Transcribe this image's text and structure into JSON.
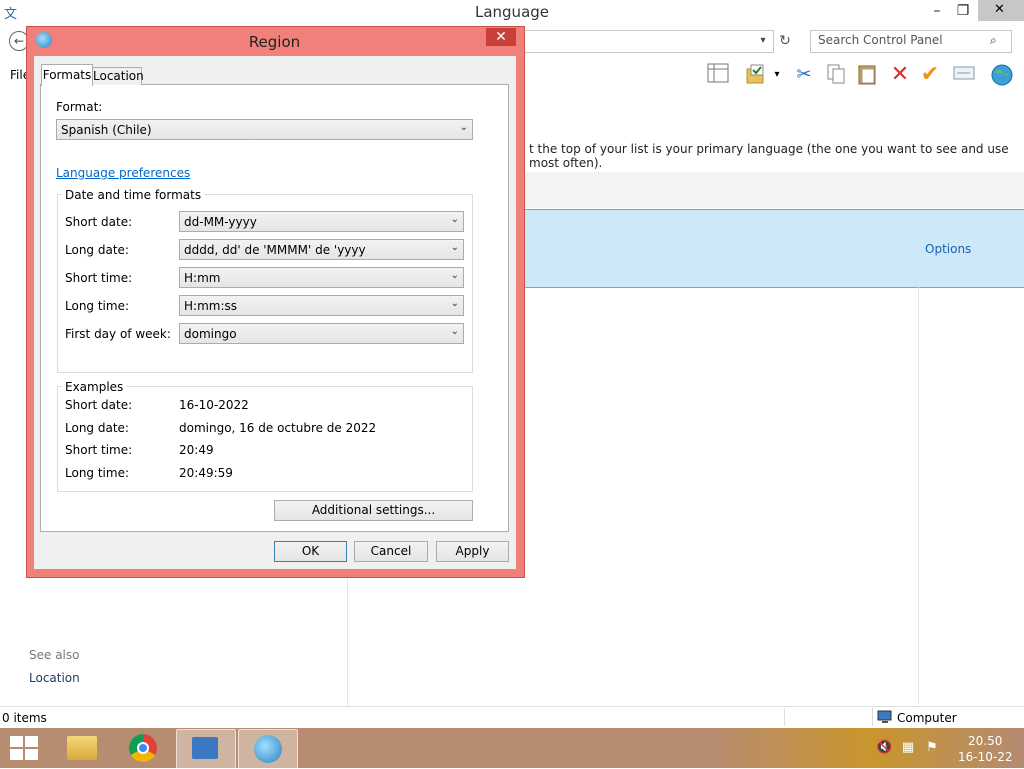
{
  "window": {
    "title": "Language",
    "min_glyph": "–",
    "max_glyph": "❐",
    "close_glyph": "✕"
  },
  "nav": {
    "back_glyph": "←",
    "dropdown_glyph": "▾",
    "refresh_glyph": "↻",
    "search_placeholder": "Search Control Panel",
    "search_glyph": "⌕"
  },
  "menu": {
    "file": "File"
  },
  "toolbar_icons": [
    "layout-icon",
    "folder-check-icon",
    "cut-icon",
    "copy-icon",
    "paste-icon",
    "delete-icon",
    "checkmark-icon",
    "properties-icon",
    "globe-icon"
  ],
  "content": {
    "description": "t the top of your list is your primary language (the one you want to see and use most often).",
    "options_link": "Options",
    "see_also": "See also",
    "location_link": "Location"
  },
  "status": {
    "items": "0 items",
    "computer": "Computer"
  },
  "taskbar": {
    "clock_time": "20.50",
    "clock_date": "16-10-22"
  },
  "dialog": {
    "title": "Region",
    "close_glyph": "✕",
    "tabs": [
      "Formats",
      "Location"
    ],
    "format_label": "Format:",
    "format_value": "Spanish (Chile)",
    "language_prefs": "Language preferences",
    "dt_group_title": "Date and time formats",
    "fields": [
      {
        "label": "Short date:",
        "value": "dd-MM-yyyy"
      },
      {
        "label": "Long date:",
        "value": "dddd, dd' de 'MMMM' de 'yyyy"
      },
      {
        "label": "Short time:",
        "value": "H:mm"
      },
      {
        "label": "Long time:",
        "value": "H:mm:ss"
      },
      {
        "label": "First day of week:",
        "value": "domingo"
      }
    ],
    "examples_title": "Examples",
    "examples": [
      {
        "label": "Short date:",
        "value": "16-10-2022"
      },
      {
        "label": "Long date:",
        "value": "domingo, 16 de octubre de 2022"
      },
      {
        "label": "Short time:",
        "value": "20:49"
      },
      {
        "label": "Long time:",
        "value": "20:49:59"
      }
    ],
    "additional_settings": "Additional settings...",
    "ok": "OK",
    "cancel": "Cancel",
    "apply": "Apply",
    "arrow_glyph": "⌄"
  },
  "colors": {
    "dialog_frame": "#f08079",
    "selection": "#cde8f7",
    "link": "#0066cc"
  }
}
